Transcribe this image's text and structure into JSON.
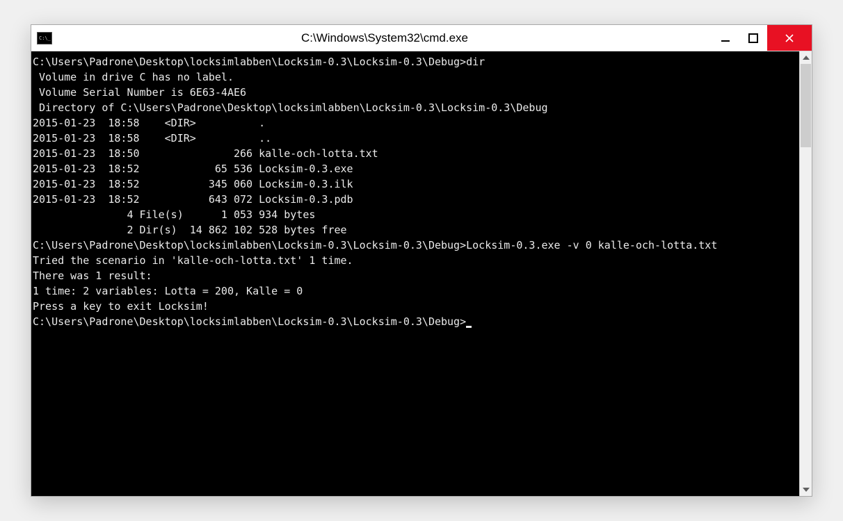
{
  "window": {
    "title": "C:\\Windows\\System32\\cmd.exe"
  },
  "terminal": {
    "lines": [
      "C:\\Users\\Padrone\\Desktop\\locksimlabben\\Locksim-0.3\\Locksim-0.3\\Debug>dir",
      " Volume in drive C has no label.",
      " Volume Serial Number is 6E63-4AE6",
      "",
      " Directory of C:\\Users\\Padrone\\Desktop\\locksimlabben\\Locksim-0.3\\Locksim-0.3\\Debug",
      "",
      "2015-01-23  18:58    <DIR>          .",
      "2015-01-23  18:58    <DIR>          ..",
      "2015-01-23  18:50               266 kalle-och-lotta.txt",
      "2015-01-23  18:52            65 536 Locksim-0.3.exe",
      "2015-01-23  18:52           345 060 Locksim-0.3.ilk",
      "2015-01-23  18:52           643 072 Locksim-0.3.pdb",
      "               4 File(s)      1 053 934 bytes",
      "               2 Dir(s)  14 862 102 528 bytes free",
      "",
      "C:\\Users\\Padrone\\Desktop\\locksimlabben\\Locksim-0.3\\Locksim-0.3\\Debug>Locksim-0.3.exe -v 0 kalle-och-lotta.txt",
      "Tried the scenario in 'kalle-och-lotta.txt' 1 time.",
      "There was 1 result:",
      "1 time: 2 variables: Lotta = 200, Kalle = 0",
      "Press a key to exit Locksim!",
      "",
      "C:\\Users\\Padrone\\Desktop\\locksimlabben\\Locksim-0.3\\Locksim-0.3\\Debug>"
    ]
  }
}
